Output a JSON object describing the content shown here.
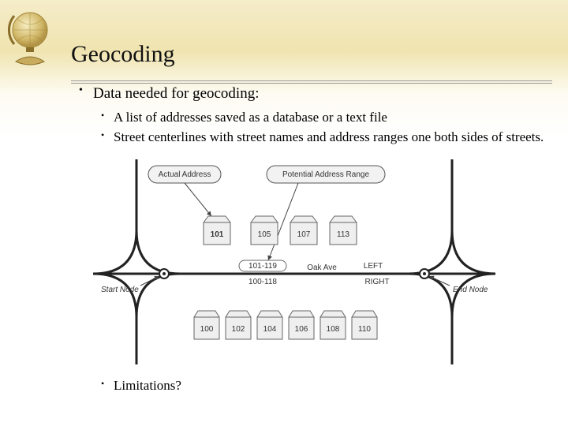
{
  "title": "Geocoding",
  "bullets": {
    "main": "Data needed for geocoding:",
    "sub1": "A list of addresses saved as a database or a text file",
    "sub2": "Street centerlines with street names and address ranges one both sides of streets.",
    "sub3": "Limitations?"
  },
  "diagram": {
    "actual_address_label": "Actual Address",
    "potential_range_label": "Potential Address Range",
    "actual_address_value": "101",
    "top_houses": [
      "105",
      "107",
      "113"
    ],
    "range_top": "101-119",
    "range_bottom": "100-118",
    "street_name": "Oak Ave",
    "left_label": "LEFT",
    "right_label": "RIGHT",
    "start_node": "Start Node",
    "end_node": "End Node",
    "bottom_houses": [
      "100",
      "102",
      "104",
      "106",
      "108",
      "110"
    ]
  }
}
